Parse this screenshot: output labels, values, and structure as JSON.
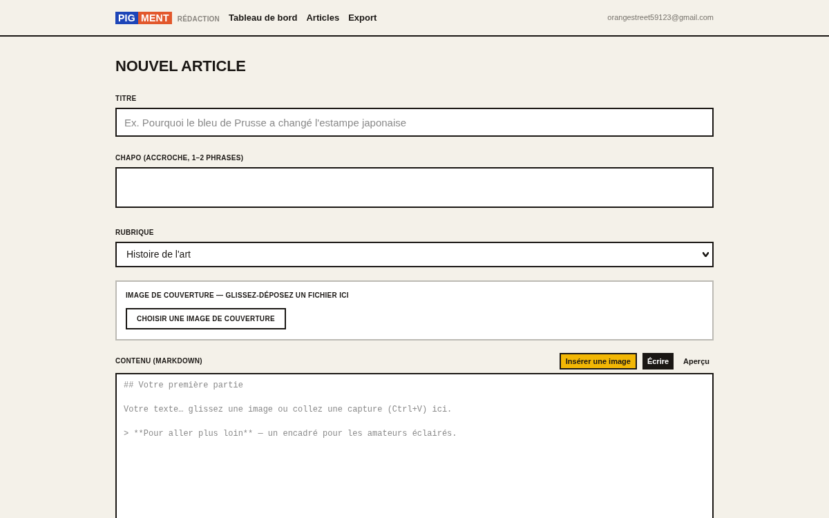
{
  "header": {
    "logo": [
      {
        "text": "PIG",
        "color": "#1d45b8"
      },
      {
        "text": "MENT",
        "color": "#e2582c"
      }
    ],
    "section": "RÉDACTION",
    "nav": [
      {
        "label": "Tableau de bord"
      },
      {
        "label": "Articles"
      },
      {
        "label": "Export"
      }
    ],
    "user_email": "orangestreet59123@gmail.com"
  },
  "page_title": "NOUVEL ARTICLE",
  "form": {
    "title_field": {
      "label": "TITRE",
      "placeholder": "Ex. Pourquoi le bleu de Prusse a changé l'estampe japonaise"
    },
    "standfirst_field": {
      "label": "CHAPO (ACCROCHE, 1–2 PHRASES)"
    },
    "category_field": {
      "label": "RUBRIQUE",
      "value": "Histoire de l'art"
    },
    "cover_image": {
      "label": "IMAGE DE COUVERTURE — GLISSEZ-DÉPOSEZ UN FICHIER ICI",
      "button": "CHOISIR UNE IMAGE DE COUVERTURE"
    },
    "content": {
      "label": "CONTENU (MARKDOWN)",
      "insert_button": "Insérer une image",
      "tabs": [
        {
          "label": "Écrire",
          "selected": true
        },
        {
          "label": "Aperçu",
          "selected": false
        }
      ],
      "placeholder": "## Votre première partie\n\nVotre texte… glissez une image ou collez une capture (Ctrl+V) ici.\n\n> **Pour aller plus loin** — un encadré pour les amateurs éclairés."
    }
  }
}
